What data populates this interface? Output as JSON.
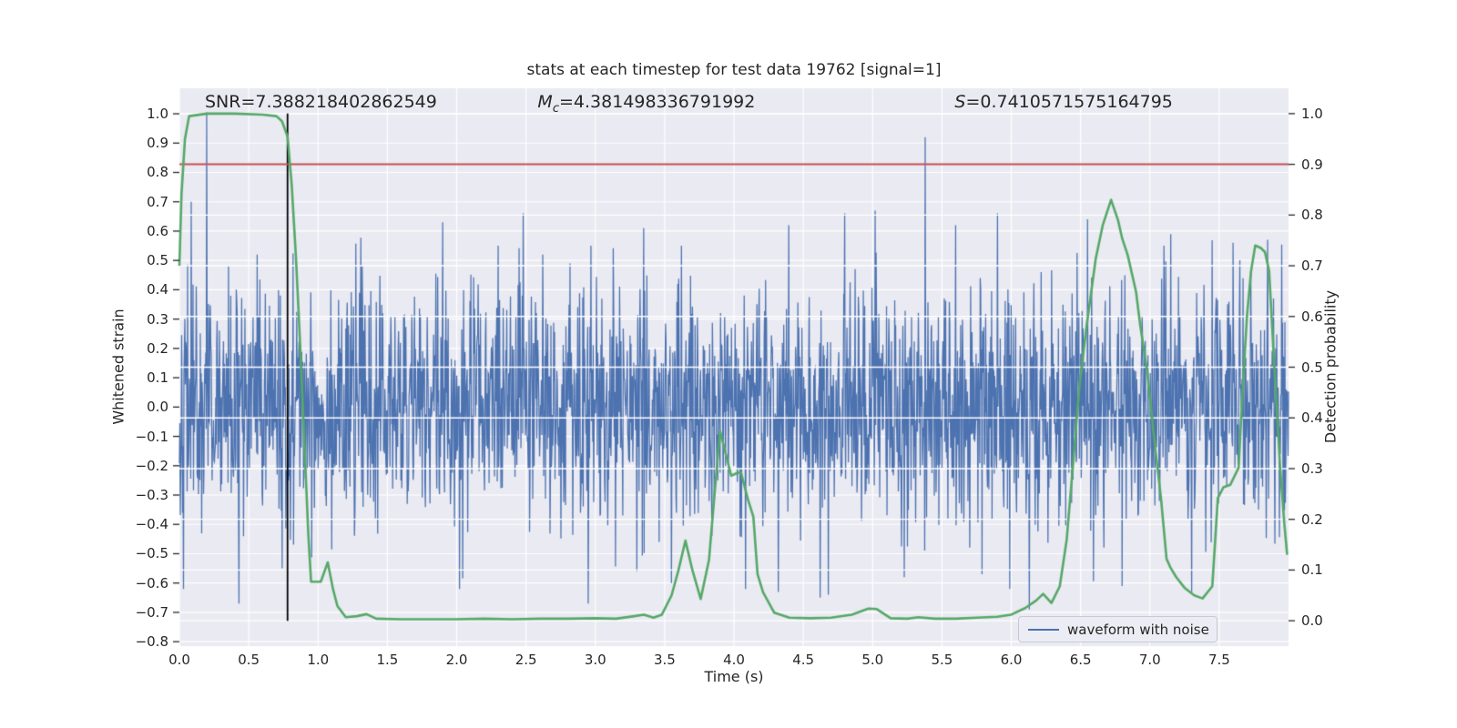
{
  "chart_data": {
    "type": "line",
    "title": "stats at each timestep for test data 19762 [signal=1]",
    "xlabel": "Time (s)",
    "ylabel_left": "Whitened strain",
    "ylabel_right": "Detection probability",
    "xlim": [
      0,
      8
    ],
    "ylim_left": [
      -0.815,
      1.087
    ],
    "ylim_right": [
      -0.05,
      1.05
    ],
    "grid": true,
    "annotations": {
      "snr": {
        "text": "SNR=7.388218402862549",
        "x_frac": 0.023
      },
      "mc": {
        "prefix": "M",
        "sub": "c",
        "value": "=4.381498336791992",
        "x_frac": 0.323
      },
      "s": {
        "prefix": "S",
        "value": "=0.7410571575164795",
        "x_frac": 0.699
      }
    },
    "x_ticks": {
      "values": [
        0,
        0.5,
        1,
        1.5,
        2,
        2.5,
        3,
        3.5,
        4,
        4.5,
        5,
        5.5,
        6,
        6.5,
        7,
        7.5
      ],
      "labels": [
        "0.0",
        "0.5",
        "1.0",
        "1.5",
        "2.0",
        "2.5",
        "3.0",
        "3.5",
        "4.0",
        "4.5",
        "5.0",
        "5.5",
        "6.0",
        "6.5",
        "7.0",
        "7.5"
      ]
    },
    "y_ticks_left": {
      "values": [
        1.0,
        0.9,
        0.8,
        0.7,
        0.6,
        0.5,
        0.4,
        0.3,
        0.2,
        0.1,
        0.0,
        -0.1,
        -0.2,
        -0.3,
        -0.4,
        -0.5,
        -0.6,
        -0.7,
        -0.8
      ],
      "labels": [
        "1.0",
        "0.9",
        "0.8",
        "0.7",
        "0.6",
        "0.5",
        "0.4",
        "0.3",
        "0.2",
        "0.1",
        "0.0",
        "−0.1",
        "−0.2",
        "−0.3",
        "−0.4",
        "−0.5",
        "−0.6",
        "−0.7",
        "−0.8"
      ]
    },
    "y_ticks_right": {
      "values": [
        1.0,
        0.9,
        0.8,
        0.7,
        0.6,
        0.5,
        0.4,
        0.3,
        0.2,
        0.1,
        0.0
      ],
      "labels": [
        "1.0",
        "0.9",
        "0.8",
        "0.7",
        "0.6",
        "0.5",
        "0.4",
        "0.3",
        "0.2",
        "0.1",
        "0.0"
      ]
    },
    "colors": {
      "plot_bg": "#eaeaf2",
      "grid": "#ffffff",
      "waveform": "#4c72b0",
      "probability": "#55a868",
      "threshold": "#c44e52",
      "vline": "#000000",
      "text": "#262626"
    },
    "threshold_line": {
      "axis": "right",
      "value": 0.9
    },
    "vline": {
      "time": 0.78,
      "from": 0.0,
      "to": 1.0
    },
    "legend": {
      "label": "waveform with noise",
      "position": "lower right"
    },
    "series": [
      {
        "name": "waveform with noise",
        "type": "noise",
        "axis": "left",
        "sigma": 0.2,
        "seed": 42,
        "samples": 2440,
        "clip": 0.62,
        "outliers": [
          [
            0.085,
            0.7
          ],
          [
            0.196,
            1.005
          ],
          [
            0.43,
            -0.67
          ],
          [
            0.56,
            0.52
          ],
          [
            0.74,
            -0.55
          ],
          [
            1.32,
            0.48
          ],
          [
            1.9,
            0.63
          ],
          [
            2.02,
            -0.62
          ],
          [
            2.3,
            0.55
          ],
          [
            2.48,
            0.66
          ],
          [
            2.62,
            0.52
          ],
          [
            2.95,
            -0.67
          ],
          [
            2.97,
            0.55
          ],
          [
            3.3,
            -0.56
          ],
          [
            3.35,
            0.61
          ],
          [
            3.55,
            -0.6
          ],
          [
            3.62,
            0.55
          ],
          [
            4.32,
            -0.63
          ],
          [
            4.62,
            -0.65
          ],
          [
            4.68,
            -0.64
          ],
          [
            4.8,
            0.66
          ],
          [
            5.02,
            0.67
          ],
          [
            5.23,
            -0.58
          ],
          [
            5.38,
            0.92
          ],
          [
            5.6,
            0.62
          ],
          [
            5.79,
            -0.57
          ],
          [
            5.9,
            0.66
          ],
          [
            5.99,
            -0.62
          ],
          [
            6.13,
            -0.69
          ],
          [
            6.55,
            0.64
          ],
          [
            6.8,
            -0.61
          ],
          [
            7.1,
            0.55
          ],
          [
            7.3,
            -0.63
          ],
          [
            7.6,
            0.56
          ],
          [
            7.85,
            0.57
          ]
        ]
      },
      {
        "name": "detection probability",
        "type": "polyline",
        "axis": "right",
        "points": [
          [
            0.0,
            0.7
          ],
          [
            0.015,
            0.84
          ],
          [
            0.04,
            0.95
          ],
          [
            0.07,
            0.995
          ],
          [
            0.2,
            1.0
          ],
          [
            0.4,
            1.0
          ],
          [
            0.6,
            0.998
          ],
          [
            0.7,
            0.995
          ],
          [
            0.74,
            0.985
          ],
          [
            0.78,
            0.955
          ],
          [
            0.81,
            0.86
          ],
          [
            0.84,
            0.72
          ],
          [
            0.87,
            0.55
          ],
          [
            0.9,
            0.36
          ],
          [
            0.93,
            0.17
          ],
          [
            0.95,
            0.077
          ],
          [
            1.02,
            0.077
          ],
          [
            1.07,
            0.115
          ],
          [
            1.11,
            0.06
          ],
          [
            1.14,
            0.029
          ],
          [
            1.2,
            0.007
          ],
          [
            1.28,
            0.009
          ],
          [
            1.35,
            0.013
          ],
          [
            1.42,
            0.004
          ],
          [
            1.6,
            0.003
          ],
          [
            1.8,
            0.003
          ],
          [
            2.0,
            0.003
          ],
          [
            2.2,
            0.004
          ],
          [
            2.4,
            0.003
          ],
          [
            2.6,
            0.004
          ],
          [
            2.8,
            0.004
          ],
          [
            3.0,
            0.005
          ],
          [
            3.15,
            0.004
          ],
          [
            3.28,
            0.009
          ],
          [
            3.35,
            0.012
          ],
          [
            3.42,
            0.006
          ],
          [
            3.48,
            0.012
          ],
          [
            3.55,
            0.05
          ],
          [
            3.6,
            0.1
          ],
          [
            3.65,
            0.158
          ],
          [
            3.7,
            0.1
          ],
          [
            3.76,
            0.043
          ],
          [
            3.82,
            0.12
          ],
          [
            3.86,
            0.25
          ],
          [
            3.9,
            0.374
          ],
          [
            3.94,
            0.33
          ],
          [
            3.98,
            0.286
          ],
          [
            4.02,
            0.291
          ],
          [
            4.05,
            0.293
          ],
          [
            4.1,
            0.24
          ],
          [
            4.14,
            0.205
          ],
          [
            4.17,
            0.092
          ],
          [
            4.21,
            0.056
          ],
          [
            4.29,
            0.016
          ],
          [
            4.4,
            0.006
          ],
          [
            4.55,
            0.005
          ],
          [
            4.7,
            0.006
          ],
          [
            4.85,
            0.012
          ],
          [
            4.97,
            0.024
          ],
          [
            5.03,
            0.023
          ],
          [
            5.13,
            0.005
          ],
          [
            5.25,
            0.004
          ],
          [
            5.33,
            0.007
          ],
          [
            5.45,
            0.004
          ],
          [
            5.6,
            0.004
          ],
          [
            5.75,
            0.006
          ],
          [
            5.9,
            0.008
          ],
          [
            6.0,
            0.012
          ],
          [
            6.1,
            0.025
          ],
          [
            6.18,
            0.04
          ],
          [
            6.23,
            0.053
          ],
          [
            6.29,
            0.035
          ],
          [
            6.35,
            0.068
          ],
          [
            6.4,
            0.16
          ],
          [
            6.44,
            0.29
          ],
          [
            6.49,
            0.457
          ],
          [
            6.54,
            0.574
          ],
          [
            6.61,
            0.715
          ],
          [
            6.66,
            0.78
          ],
          [
            6.72,
            0.83
          ],
          [
            6.77,
            0.79
          ],
          [
            6.8,
            0.754
          ],
          [
            6.84,
            0.721
          ],
          [
            6.9,
            0.649
          ],
          [
            6.93,
            0.583
          ],
          [
            6.98,
            0.493
          ],
          [
            7.03,
            0.361
          ],
          [
            7.08,
            0.242
          ],
          [
            7.12,
            0.122
          ],
          [
            7.15,
            0.104
          ],
          [
            7.19,
            0.086
          ],
          [
            7.25,
            0.065
          ],
          [
            7.32,
            0.05
          ],
          [
            7.38,
            0.044
          ],
          [
            7.45,
            0.068
          ],
          [
            7.49,
            0.242
          ],
          [
            7.53,
            0.263
          ],
          [
            7.58,
            0.268
          ],
          [
            7.64,
            0.302
          ],
          [
            7.67,
            0.46
          ],
          [
            7.7,
            0.6
          ],
          [
            7.73,
            0.69
          ],
          [
            7.76,
            0.74
          ],
          [
            7.8,
            0.735
          ],
          [
            7.83,
            0.727
          ],
          [
            7.86,
            0.69
          ],
          [
            7.9,
            0.49
          ],
          [
            7.94,
            0.3
          ],
          [
            7.97,
            0.19
          ],
          [
            7.99,
            0.13
          ]
        ]
      }
    ]
  }
}
